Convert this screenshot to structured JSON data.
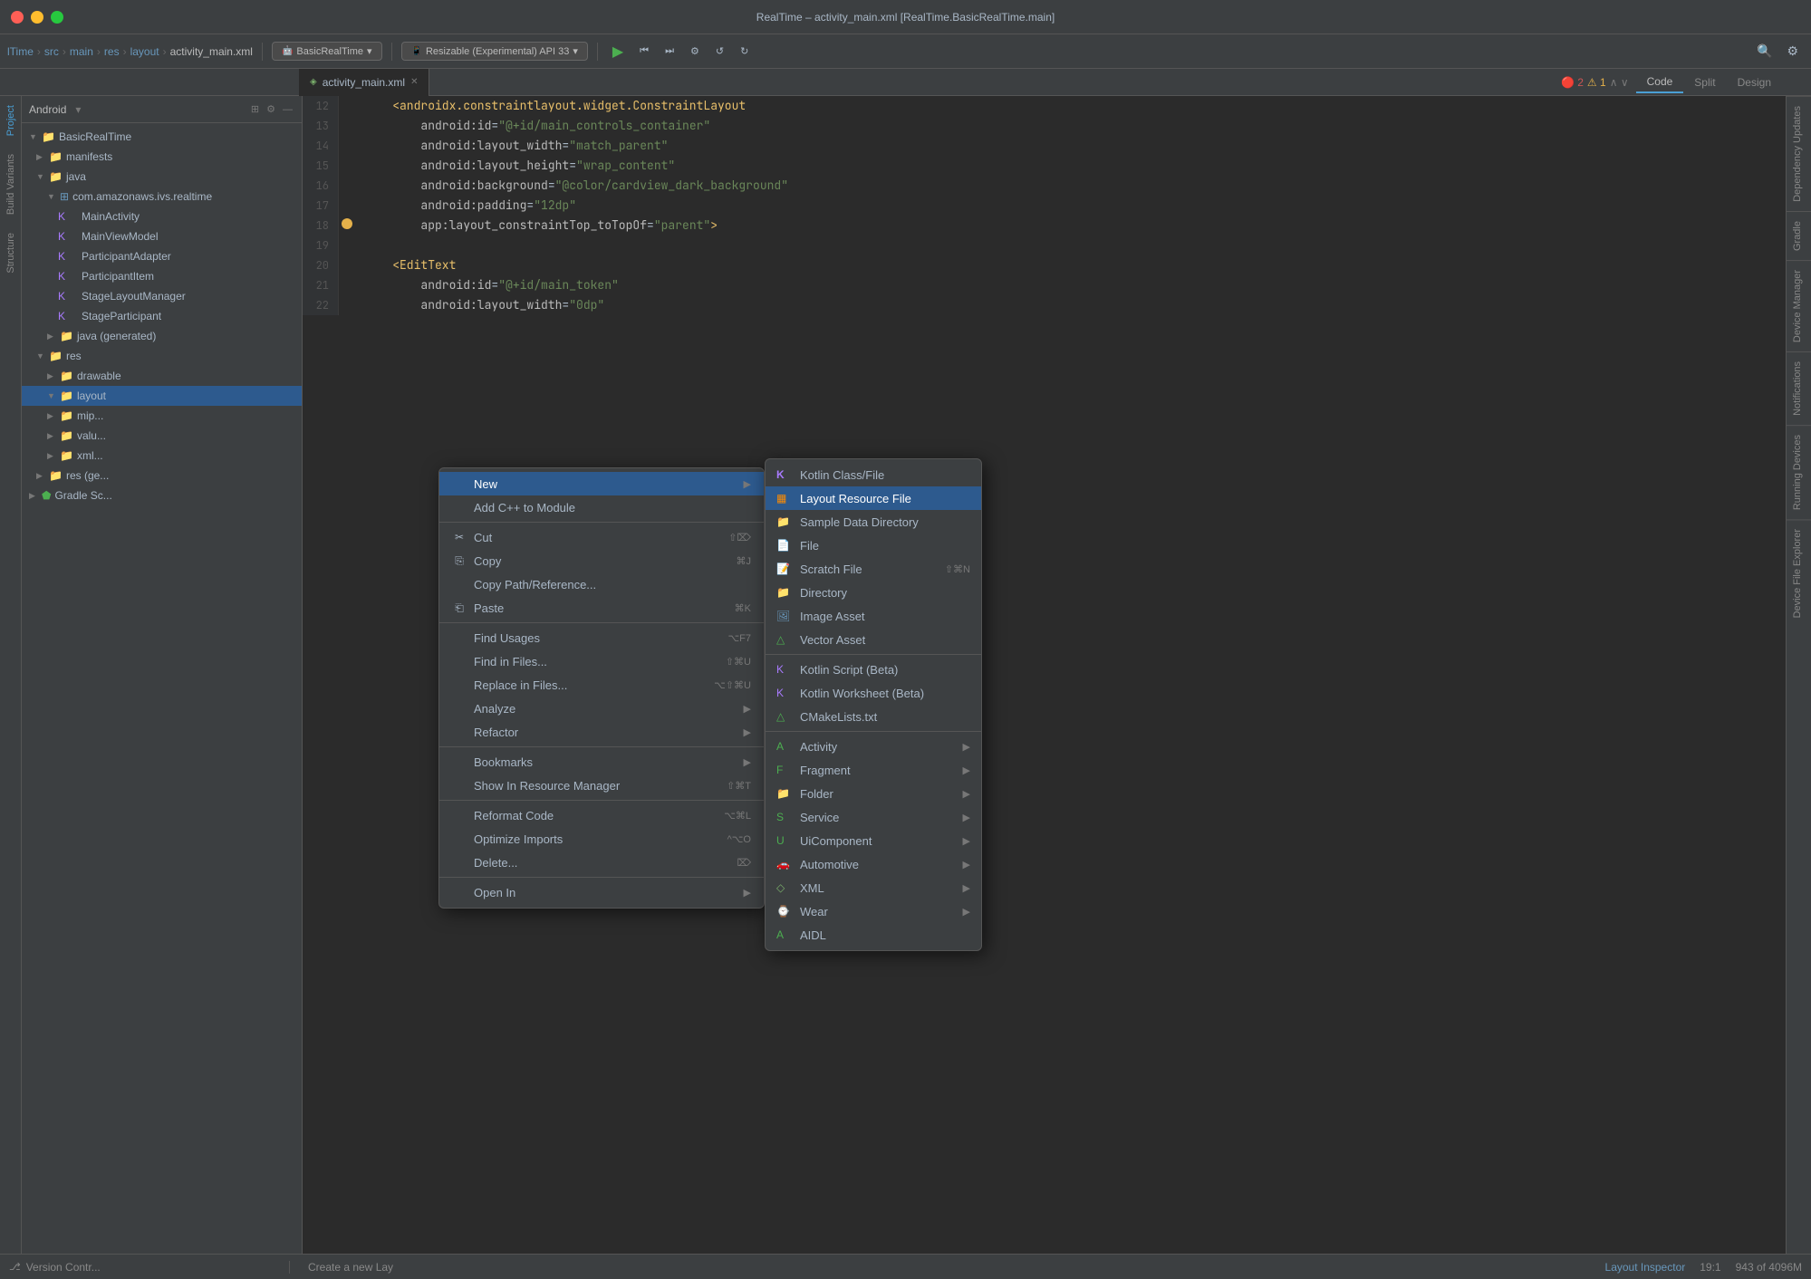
{
  "window": {
    "title": "RealTime – activity_main.xml [RealTime.BasicRealTime.main]"
  },
  "toolbar": {
    "breadcrumbs": [
      "lTime",
      "src",
      "main",
      "res",
      "layout",
      "activity_main.xml"
    ],
    "profile_selector": "BasicRealTime",
    "device_selector": "Resizable (Experimental) API 33"
  },
  "tabs": [
    {
      "label": "activity_main.xml",
      "active": true
    }
  ],
  "code_view_tabs": [
    "Code",
    "Split",
    "Design"
  ],
  "project_panel": {
    "title": "Android",
    "tree": [
      {
        "label": "BasicRealTime",
        "level": 0,
        "type": "project",
        "expanded": true
      },
      {
        "label": "manifests",
        "level": 1,
        "type": "folder",
        "expanded": false
      },
      {
        "label": "java",
        "level": 1,
        "type": "folder",
        "expanded": true
      },
      {
        "label": "com.amazonaws.ivs.realtime",
        "level": 2,
        "type": "package",
        "expanded": true
      },
      {
        "label": "MainActivity",
        "level": 3,
        "type": "kotlin"
      },
      {
        "label": "MainViewModel",
        "level": 3,
        "type": "kotlin"
      },
      {
        "label": "ParticipantAdapter",
        "level": 3,
        "type": "kotlin"
      },
      {
        "label": "ParticipantItem",
        "level": 3,
        "type": "kotlin"
      },
      {
        "label": "StageLayoutManager",
        "level": 3,
        "type": "kotlin"
      },
      {
        "label": "StageParticipant",
        "level": 3,
        "type": "kotlin"
      },
      {
        "label": "java (generated)",
        "level": 2,
        "type": "folder",
        "expanded": false
      },
      {
        "label": "res",
        "level": 1,
        "type": "folder",
        "expanded": true
      },
      {
        "label": "drawable",
        "level": 2,
        "type": "folder",
        "expanded": false
      },
      {
        "label": "layout",
        "level": 2,
        "type": "folder",
        "expanded": true,
        "selected": true
      },
      {
        "label": "mip...",
        "level": 2,
        "type": "folder",
        "expanded": false
      },
      {
        "label": "valu...",
        "level": 2,
        "type": "folder",
        "expanded": false
      },
      {
        "label": "xml...",
        "level": 2,
        "type": "folder",
        "expanded": false
      },
      {
        "label": "res (ge...",
        "level": 1,
        "type": "folder",
        "expanded": false
      },
      {
        "label": "Gradle Sc...",
        "level": 0,
        "type": "gradle",
        "expanded": false
      }
    ]
  },
  "context_menu": {
    "items": [
      {
        "label": "New",
        "highlighted": true,
        "has_arrow": true
      },
      {
        "label": "Add C++ to Module",
        "separator_after": true
      },
      {
        "label": "Cut",
        "icon": "✂",
        "shortcut": "⇧⌦"
      },
      {
        "label": "Copy",
        "icon": "",
        "shortcut": "⌘J"
      },
      {
        "label": "Copy Path/Reference...",
        "icon": ""
      },
      {
        "label": "Paste",
        "icon": "",
        "shortcut": "⌘K",
        "separator_after": true
      },
      {
        "label": "Find Usages",
        "shortcut": "⌥F7"
      },
      {
        "label": "Find in Files...",
        "shortcut": "⇧⌘U"
      },
      {
        "label": "Replace in Files...",
        "shortcut": "⌥⇧⌘U"
      },
      {
        "label": "Analyze",
        "has_arrow": true
      },
      {
        "label": "Refactor",
        "has_arrow": true,
        "separator_after": true
      },
      {
        "label": "Bookmarks",
        "has_arrow": true
      },
      {
        "label": "Show In Resource Manager",
        "shortcut": "⇧⌘T",
        "separator_after": true
      },
      {
        "label": "Reformat Code",
        "shortcut": "⌥⌘L"
      },
      {
        "label": "Optimize Imports",
        "shortcut": "^⌥O"
      },
      {
        "label": "Delete...",
        "shortcut": "⌦",
        "separator_after": true
      },
      {
        "label": "Open In",
        "has_arrow": true
      }
    ]
  },
  "sub_menu": {
    "items": [
      {
        "label": "Kotlin Class/File",
        "icon": "K"
      },
      {
        "label": "Layout Resource File",
        "icon": "▦",
        "highlighted": true
      },
      {
        "label": "Sample Data Directory",
        "icon": "📁"
      },
      {
        "label": "File",
        "icon": "📄"
      },
      {
        "label": "Scratch File",
        "icon": "📝",
        "shortcut": "⇧⌘N"
      },
      {
        "label": "Directory",
        "icon": "📁"
      },
      {
        "label": "Image Asset",
        "icon": "🖼"
      },
      {
        "label": "Vector Asset",
        "icon": "△"
      },
      {
        "separator": true
      },
      {
        "label": "Kotlin Script (Beta)",
        "icon": "K"
      },
      {
        "label": "Kotlin Worksheet (Beta)",
        "icon": "K"
      },
      {
        "label": "CMakeLists.txt",
        "icon": "△"
      },
      {
        "separator": true
      },
      {
        "label": "Activity",
        "icon": "A",
        "has_arrow": true
      },
      {
        "label": "Fragment",
        "icon": "F",
        "has_arrow": true
      },
      {
        "label": "Folder",
        "icon": "📁",
        "has_arrow": true
      },
      {
        "label": "Service",
        "icon": "S",
        "has_arrow": true
      },
      {
        "label": "UiComponent",
        "icon": "U",
        "has_arrow": true
      },
      {
        "label": "Automotive",
        "icon": "🚗",
        "has_arrow": true
      },
      {
        "label": "XML",
        "icon": "◇",
        "has_arrow": true
      },
      {
        "label": "Wear",
        "icon": "⌚",
        "has_arrow": true
      },
      {
        "label": "AIDL",
        "icon": "A"
      }
    ]
  },
  "editor": {
    "lines": [
      {
        "num": "12",
        "text": "    <androidx.constraintlayout.widget.ConstraintLayout"
      },
      {
        "num": "13",
        "text": "        android:id=\"@+id/main_controls_container\""
      },
      {
        "num": "14",
        "text": "        android:layout_width=\"match_parent\""
      },
      {
        "num": "15",
        "text": "        android:layout_height=\"wrap_content\""
      },
      {
        "num": "16",
        "text": "        android:background=\"@color/cardview_dark_background\""
      },
      {
        "num": "17",
        "text": "        android:padding=\"12dp\""
      },
      {
        "num": "18",
        "text": "        app:layout_constraintTop_toTopOf=\"parent\">"
      },
      {
        "num": "19",
        "text": ""
      },
      {
        "num": "20",
        "text": "    <EditText"
      },
      {
        "num": "21",
        "text": "        android:id=\"@+id/main_token\""
      },
      {
        "num": "22",
        "text": "        android:layout_width=\"0dp\""
      }
    ],
    "line_18_has_bulb": true
  },
  "error_indicators": {
    "errors": "2",
    "warnings": "1"
  },
  "right_panels": [
    "Dependency Updates",
    "Gradle",
    "Device Manager",
    "Notifications",
    "Running Devices",
    "Device File Explorer"
  ],
  "left_vtabs": [
    "Project",
    "Build Variants",
    "Structure"
  ],
  "bottom_bar": {
    "vc_label": "Version Contr...",
    "create_layout_label": "Create a new Lay",
    "position": "19:1",
    "memory": "943 of 4096M"
  },
  "status": {
    "layout_inspector": "Layout Inspector"
  }
}
